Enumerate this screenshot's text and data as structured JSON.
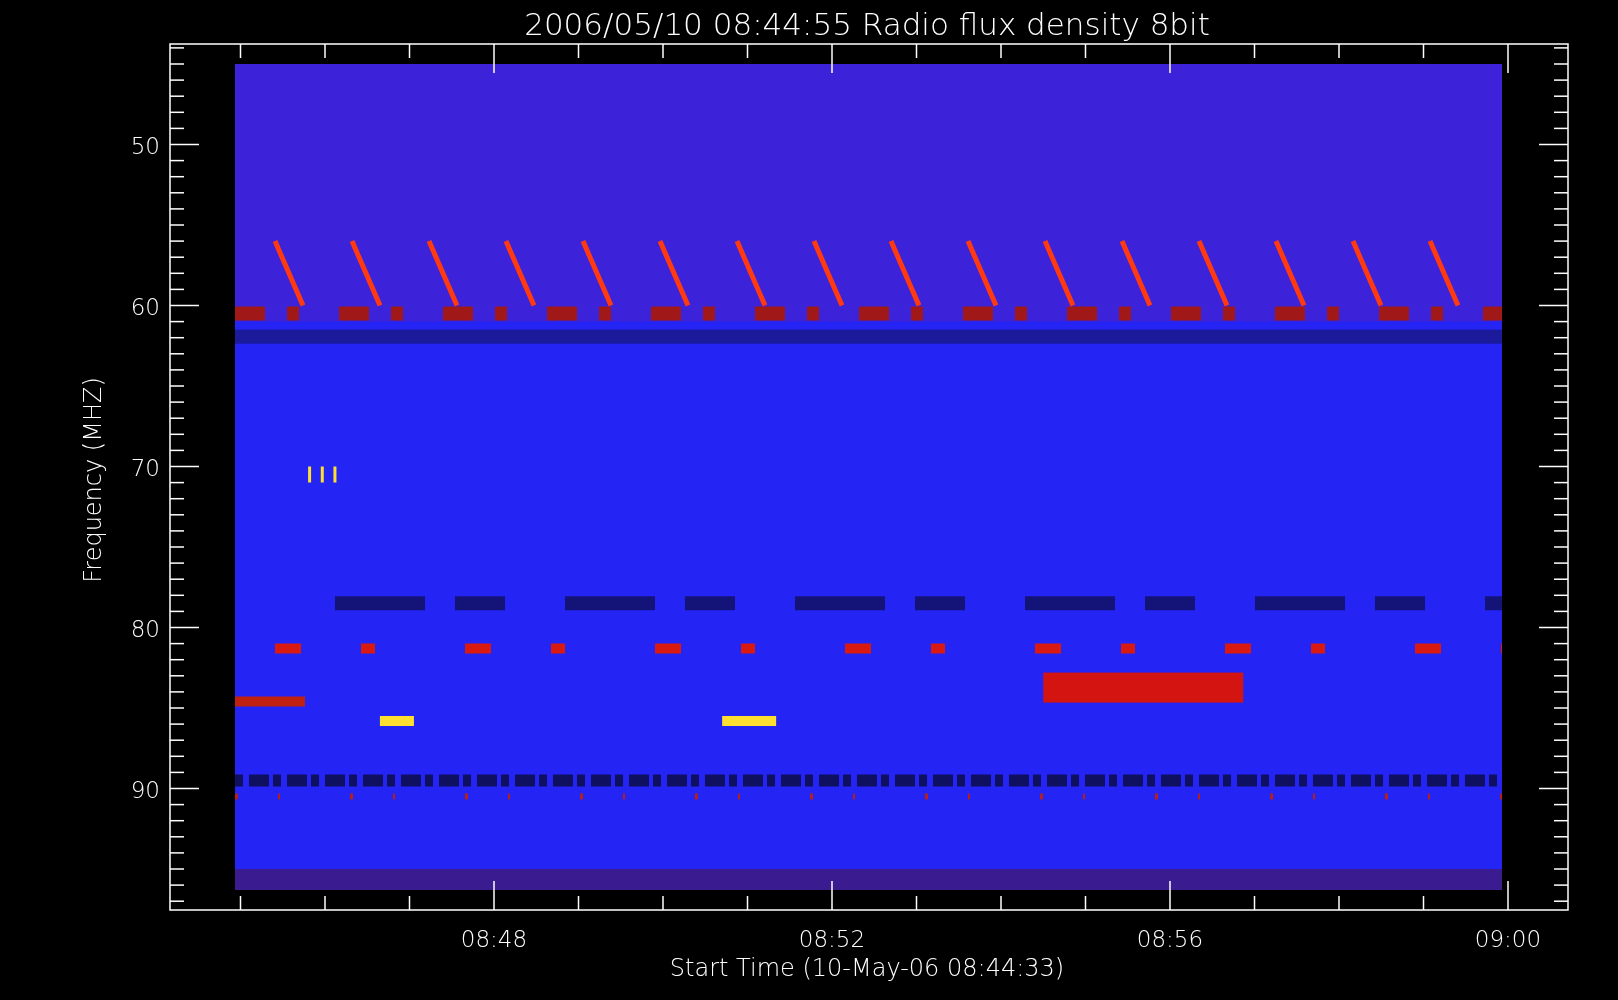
{
  "title": "2006/05/10 08:44:55 Radio flux density 8bit",
  "y_axis": {
    "title": "Frequency (MHZ)",
    "ticks": [
      "50",
      "60",
      "70",
      "80",
      "90"
    ]
  },
  "x_axis": {
    "title": "Start Time (10-May-06 08:44:33)",
    "ticks": [
      "08:48",
      "08:52",
      "08:56",
      "09:00"
    ]
  }
}
